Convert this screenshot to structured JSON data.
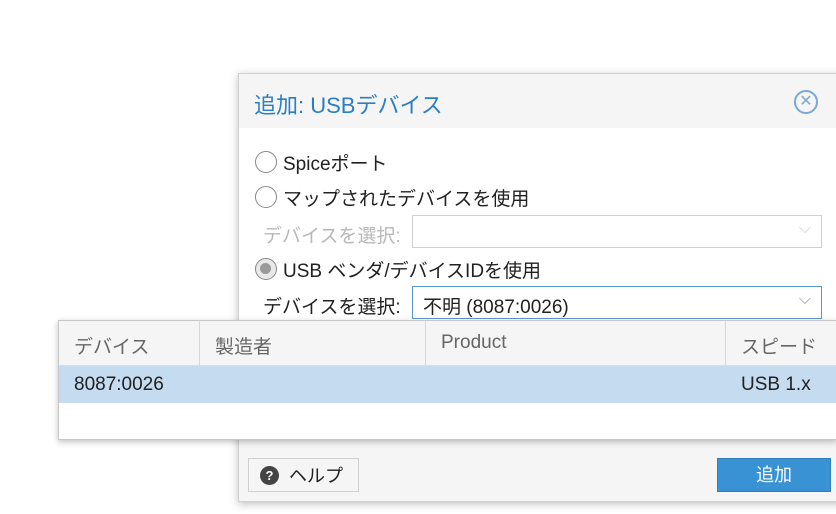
{
  "dialog": {
    "title": "追加: USBデバイス",
    "close_icon": "close-icon",
    "options": [
      {
        "label": "Spiceポート",
        "checked": false
      },
      {
        "label": "マップされたデバイスを使用",
        "checked": false
      },
      {
        "label": "USB ベンダ/デバイスIDを使用",
        "checked": true
      }
    ],
    "mapped_device": {
      "label": "デバイスを選択:",
      "value": "",
      "disabled": true
    },
    "vendor_device": {
      "label": "デバイスを選択:",
      "value": "不明 (8087:0026)"
    },
    "footer": {
      "help_label": "ヘルプ",
      "help_icon": "question-circle-icon",
      "add_label": "追加"
    }
  },
  "dropdown": {
    "columns": [
      "デバイス",
      "製造者",
      "Product",
      "スピード"
    ],
    "rows": [
      {
        "device": "8087:0026",
        "manufacturer": "",
        "product": "",
        "speed": "USB 1.x",
        "selected": true
      }
    ]
  },
  "colors": {
    "accent": "#2a7fc4",
    "button": "#3892d4",
    "selected_row": "#c5dcf0"
  }
}
